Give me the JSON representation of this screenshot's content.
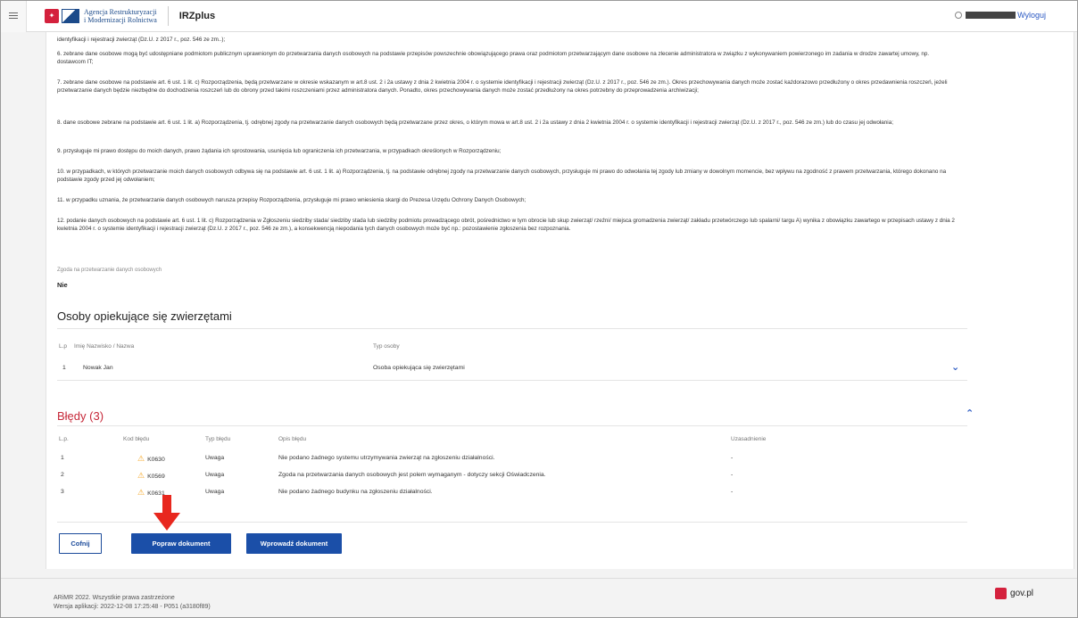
{
  "header": {
    "agency_line1": "Agencja Restrukturyzacji",
    "agency_line2": "i Modernizacji Rolnictwa",
    "app_name": "IRZplus",
    "logout": "Wyloguj"
  },
  "consent": {
    "paragraphs": [
      "identyfikacji i rejestracji zwierząt (Dz.U. z 2017 r., poz. 546 ze zm..);",
      "6. zebrane dane osobowe mogą być udostępniane podmiotom publicznym uprawnionym do przetwarzania danych osobowych na podstawie przepisów powszechnie obowiązującego prawa oraz podmiotom przetwarzającym dane osobowe na zlecenie administratora w związku z wykonywaniem powierzonego im zadania w drodze zawartej umowy, np. dostawcom IT;",
      "7. zebrane dane osobowe na podstawie art. 6 ust. 1 lit. c) Rozporządzenia, będą przetwarzane w okresie wskazanym w art.8 ust. 2 i 2a ustawy z dnia 2 kwietnia 2004 r. o systemie identyfikacji i rejestracji zwierząt (Dz.U. z 2017 r., poz. 546 ze zm.). Okres przechowywania danych może zostać każdorazowo przedłużony o okres przedawnienia roszczeń, jeżeli przetwarzanie danych będzie niezbędne do dochodzenia roszczeń lub do obrony przed takimi roszczeniami przez administratora danych. Ponadto, okres przechowywania danych może zostać przedłużony na okres potrzebny do przeprowadzenia archiwizacji;",
      "8. dane osobowe zebrane na podstawie art. 6 ust. 1 lit. a) Rozporządzenia, tj. odrębnej zgody na przetwarzanie danych osobowych będą przetwarzane przez okres, o którym mowa w art.8 ust. 2 i 2a ustawy z dnia 2 kwietnia 2004 r. o systemie identyfikacji i rejestracji zwierząt (Dz.U. z 2017 r., poz. 546 ze zm.) lub do czasu jej odwołania;",
      "9. przysługuje mi prawo dostępu do moich danych, prawo żądania ich sprostowania, usunięcia lub ograniczenia ich przetwarzania, w przypadkach określonych w Rozporządzeniu;",
      "10. w przypadkach, w których przetwarzanie moich danych osobowych odbywa się na podstawie art. 6 ust. 1 lit. a) Rozporządzenia, tj. na podstawie odrębnej zgody na przetwarzanie danych osobowych, przysługuje mi prawo do odwołania tej zgody lub zmiany w dowolnym momencie, bez wpływu na zgodność z prawem przetwarzania, którego dokonano na podstawie zgody przed jej odwołaniem;",
      "11. w przypadku uznania, że przetwarzanie danych osobowych narusza przepisy Rozporządzenia, przysługuje mi prawo wniesienia skargi do Prezesa Urzędu Ochrony Danych Osobowych;",
      "12. podanie danych osobowych na podstawie art. 6 ust. 1 lit. c) Rozporządzenia w Zgłoszeniu siedziby stada/ siedziby stada lub siedziby podmiotu prowadzącego obrót, pośrednictwo w tym obrocie lub skup zwierząt/ rzeźni/ miejsca gromadzenia zwierząt/ zakładu przetwórczego lub spalarni/ targu A) wynika z obowiązku zawartego w przepisach ustawy z dnia 2 kwietnia 2004 r. o systemie identyfikacji i rejestracji zwierząt (Dz.U. z 2017 r., poz. 546 ze zm.), a konsekwencją niepodania tych danych osobowych może być np.: pozostawienie zgłoszenia bez rozpoznania."
    ],
    "consent_label": "Zgoda na przetwarzanie danych osobowych",
    "consent_value": "Nie"
  },
  "caretakers": {
    "title": "Osoby opiekujące się zwierzętami",
    "headers": {
      "lp": "L.p",
      "name": "Imię Nazwisko / Nazwa",
      "type": "Typ osoby"
    },
    "rows": [
      {
        "lp": "1",
        "name": "Nowak Jan",
        "type": "Osoba opiekująca się zwierzętami"
      }
    ]
  },
  "errors": {
    "title": "Błędy (3)",
    "headers": {
      "lp": "L.p.",
      "code": "Kod błędu",
      "type": "Typ błędu",
      "desc": "Opis błędu",
      "reason": "Uzasadnienie"
    },
    "rows": [
      {
        "lp": "1",
        "code": "K0630",
        "type": "Uwaga",
        "desc": "Nie podano żadnego systemu utrzymywania zwierząt na zgłoszeniu działalności.",
        "reason": "-"
      },
      {
        "lp": "2",
        "code": "K0569",
        "type": "Uwaga",
        "desc": "Zgoda na przetwarzania danych osobowych jest polem wymaganym - dotyczy sekcji Oświadczenia.",
        "reason": "-"
      },
      {
        "lp": "3",
        "code": "K0631",
        "type": "Uwaga",
        "desc": "Nie podano żadnego budynku na zgłoszeniu działalności.",
        "reason": "-"
      }
    ]
  },
  "buttons": {
    "back": "Cofnij",
    "fix": "Popraw dokument",
    "submit": "Wprowadź dokument"
  },
  "footer": {
    "copyright": "ARiMR 2022. Wszystkie prawa zastrzeżone",
    "version": "Wersja aplikacji: 2022-12-08 17:25:48 - P051 (a3180f89)",
    "gov": "gov.pl"
  },
  "colors": {
    "accent": "#1b4fa8",
    "error": "#c62839",
    "warning": "#f5a623",
    "arrow": "#e8271e"
  }
}
